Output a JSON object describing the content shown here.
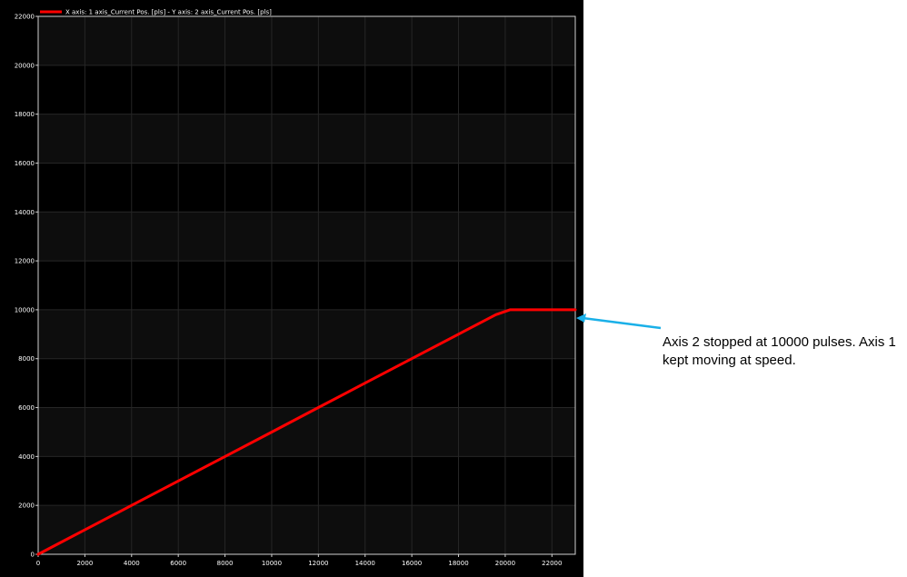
{
  "chart_data": {
    "type": "line",
    "title": "",
    "xlabel": "",
    "ylabel": "",
    "xlim": [
      0,
      23000
    ],
    "ylim": [
      0,
      22000
    ],
    "grid": true,
    "legend_position": "top-left",
    "x_ticks": [
      0,
      2000,
      4000,
      6000,
      8000,
      10000,
      12000,
      14000,
      16000,
      18000,
      20000,
      22000
    ],
    "y_ticks": [
      0,
      2000,
      4000,
      6000,
      8000,
      10000,
      12000,
      14000,
      16000,
      18000,
      20000,
      22000
    ],
    "series": [
      {
        "name": "X axis: 1 axis_Current Pos. [pls] - Y axis: 2 axis_Current Pos. [pls]",
        "color": "#ff0000",
        "x": [
          0,
          1000,
          2000,
          4000,
          6000,
          8000,
          10000,
          12000,
          14000,
          16000,
          18000,
          19600,
          20200,
          23000
        ],
        "y": [
          0,
          500,
          1000,
          2000,
          3000,
          4000,
          5000,
          6000,
          7000,
          8000,
          9000,
          9800,
          10000,
          10000
        ]
      }
    ]
  },
  "annotation": {
    "text": "Axis 2 stopped at 10000 pulses. Axis 1 kept moving at speed.",
    "arrow_color": "#1ab0e8"
  },
  "colors": {
    "plot_background": "#000000",
    "band_alt": "#0d0d0d",
    "grid": "#262626",
    "frame": "#d0d0d0"
  }
}
